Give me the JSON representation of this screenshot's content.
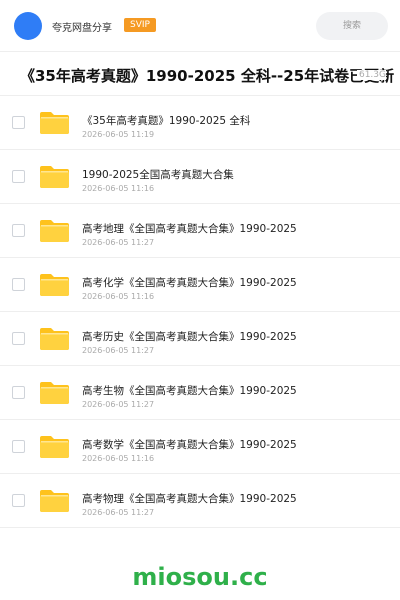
{
  "header": {
    "app_name": "夸克网盘分享",
    "badge": "SVIP",
    "search_placeholder": "搜索",
    "accent_color": "#2f7df6",
    "badge_color": "#f59a23"
  },
  "share": {
    "title": "《35年高考真题》1990-2025 全科--25年试卷已更新",
    "size": "61.3G"
  },
  "files": [
    {
      "name": "《35年高考真题》1990-2025  全科",
      "date": "2026-06-05 11:19",
      "icon": "folder-icon"
    },
    {
      "name": "1990-2025全国高考真题大合集",
      "date": "2026-06-05 11:16",
      "icon": "folder-icon"
    },
    {
      "name": "高考地理《全国高考真题大合集》1990-2025",
      "date": "2026-06-05 11:27",
      "icon": "folder-icon"
    },
    {
      "name": "高考化学《全国高考真题大合集》1990-2025",
      "date": "2026-06-05 11:16",
      "icon": "folder-icon"
    },
    {
      "name": "高考历史《全国高考真题大合集》1990-2025",
      "date": "2026-06-05 11:27",
      "icon": "folder-icon"
    },
    {
      "name": "高考生物《全国高考真题大合集》1990-2025",
      "date": "2026-06-05 11:27",
      "icon": "folder-icon"
    },
    {
      "name": "高考数学《全国高考真题大合集》1990-2025",
      "date": "2026-06-05 11:16",
      "icon": "folder-icon"
    },
    {
      "name": "高考物理《全国高考真题大合集》1990-2025",
      "date": "2026-06-05 11:27",
      "icon": "folder-icon"
    }
  ],
  "watermark": "miosou.cc"
}
